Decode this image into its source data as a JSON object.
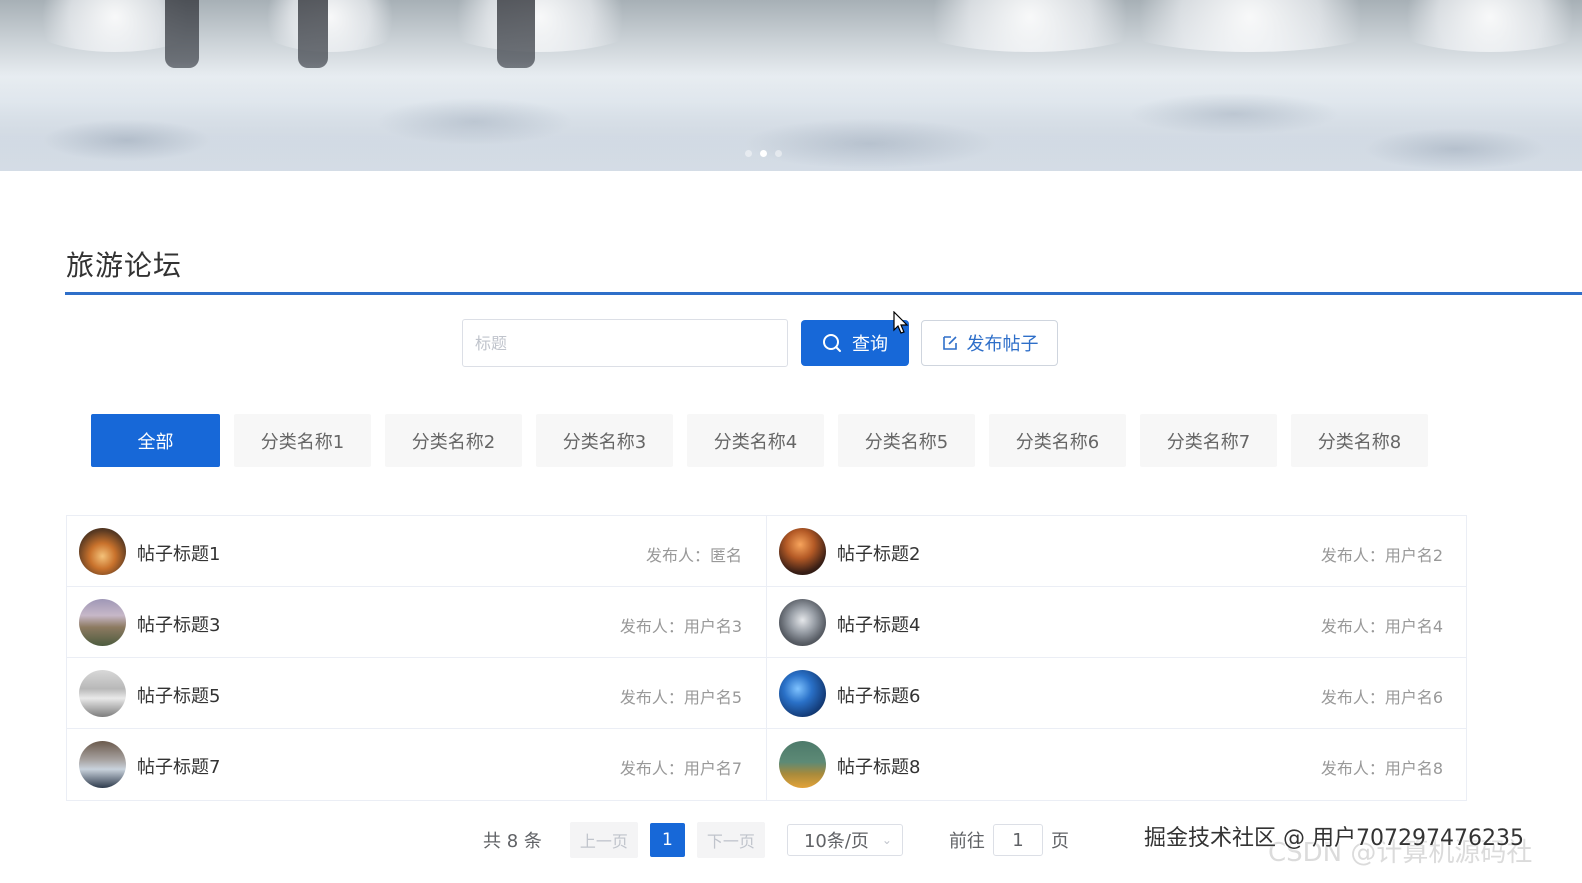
{
  "banner": {
    "slides": 3,
    "active_slide": 2
  },
  "forum": {
    "title": "旅游论坛"
  },
  "search": {
    "placeholder": "标题",
    "value": "",
    "query_label": "查询",
    "post_label": "发布帖子"
  },
  "categories": [
    {
      "label": "全部",
      "active": true
    },
    {
      "label": "分类名称1",
      "active": false
    },
    {
      "label": "分类名称2",
      "active": false
    },
    {
      "label": "分类名称3",
      "active": false
    },
    {
      "label": "分类名称4",
      "active": false
    },
    {
      "label": "分类名称5",
      "active": false
    },
    {
      "label": "分类名称6",
      "active": false
    },
    {
      "label": "分类名称7",
      "active": false
    },
    {
      "label": "分类名称8",
      "active": false
    }
  ],
  "posts": [
    {
      "title": "帖子标题1",
      "author": "发布人：匿名"
    },
    {
      "title": "帖子标题2",
      "author": "发布人：用户名2"
    },
    {
      "title": "帖子标题3",
      "author": "发布人：用户名3"
    },
    {
      "title": "帖子标题4",
      "author": "发布人：用户名4"
    },
    {
      "title": "帖子标题5",
      "author": "发布人：用户名5"
    },
    {
      "title": "帖子标题6",
      "author": "发布人：用户名6"
    },
    {
      "title": "帖子标题7",
      "author": "发布人：用户名7"
    },
    {
      "title": "帖子标题8",
      "author": "发布人：用户名8"
    }
  ],
  "pagination": {
    "total": "共 8 条",
    "prev": "上一页",
    "current_page": "1",
    "next": "下一页",
    "page_size": "10条/页",
    "goto_label": "前往",
    "goto_value": "1",
    "goto_suffix": "页"
  },
  "watermarks": {
    "juejin": "掘金技术社区 @ 用户707297476235",
    "csdn": "CSDN @计算机源码社"
  },
  "colors": {
    "primary": "#1768d8",
    "accent_line": "#2f6fc9"
  },
  "icons": {
    "query": "search-icon",
    "post": "edit-icon",
    "select": "chevron-down-icon"
  }
}
